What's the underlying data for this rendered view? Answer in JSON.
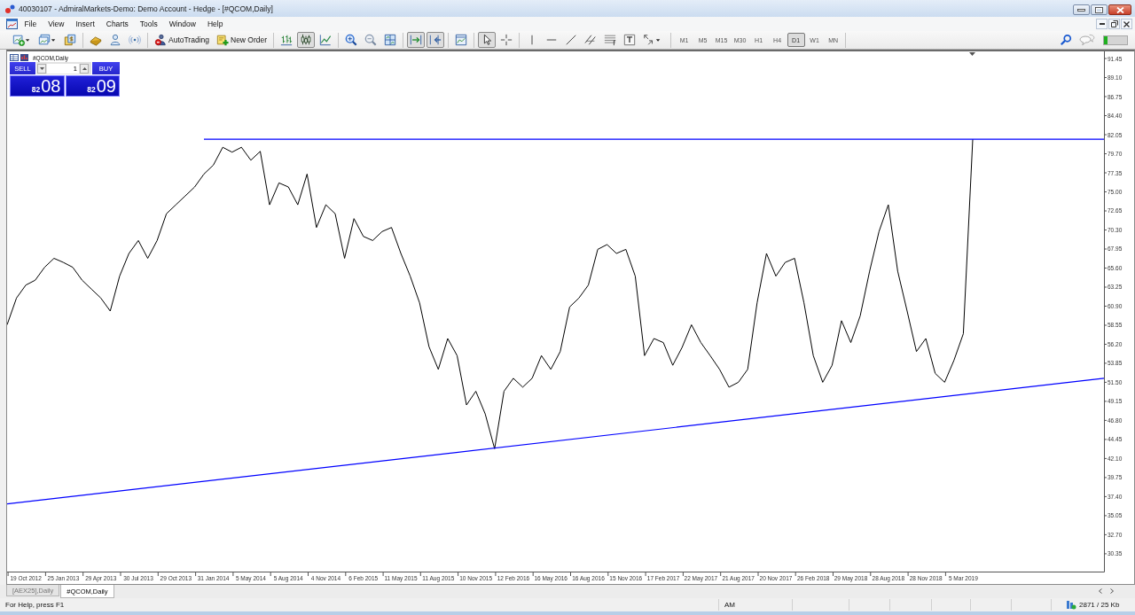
{
  "window": {
    "title": "40030107 - AdmiralMarkets-Demo: Demo Account - Hedge - [#QCOM,Daily]"
  },
  "menu": [
    "File",
    "View",
    "Insert",
    "Charts",
    "Tools",
    "Window",
    "Help"
  ],
  "toolbar": {
    "groups": [
      {
        "items": [
          {
            "kind": "new-chart",
            "pressed": false
          },
          {
            "kind": "profiles",
            "pressed": false
          },
          {
            "kind": "market-watch",
            "pressed": false
          }
        ]
      },
      {
        "items": [
          {
            "kind": "navigator",
            "pressed": false
          },
          {
            "kind": "person",
            "pressed": false
          },
          {
            "kind": "waves",
            "pressed": false
          }
        ]
      },
      {
        "items": [
          {
            "kind": "auto-trading",
            "label": "AutoTrading",
            "pressed": false
          },
          {
            "kind": "new-order",
            "label": "New Order",
            "pressed": false
          }
        ]
      },
      {
        "items": [
          {
            "kind": "bars",
            "pressed": false
          },
          {
            "kind": "candles",
            "pressed": true
          },
          {
            "kind": "line",
            "pressed": false
          }
        ]
      },
      {
        "items": [
          {
            "kind": "zoom-in",
            "pressed": false
          },
          {
            "kind": "zoom-out",
            "pressed": false
          },
          {
            "kind": "tile",
            "pressed": false
          }
        ]
      },
      {
        "items": [
          {
            "kind": "auto-scroll",
            "pressed": true
          },
          {
            "kind": "chart-shift",
            "pressed": true
          }
        ]
      },
      {
        "items": [
          {
            "kind": "templates",
            "pressed": false
          }
        ]
      },
      {
        "items": [
          {
            "kind": "cursor",
            "pressed": true
          },
          {
            "kind": "crosshair",
            "pressed": false
          }
        ]
      },
      {
        "items": [
          {
            "kind": "vline",
            "pressed": false
          },
          {
            "kind": "hline",
            "pressed": false
          },
          {
            "kind": "trendline",
            "pressed": false
          },
          {
            "kind": "channel",
            "pressed": false
          },
          {
            "kind": "fibo",
            "pressed": false
          },
          {
            "kind": "text",
            "pressed": false
          },
          {
            "kind": "arrows",
            "pressed": false
          }
        ]
      }
    ],
    "timeframes": [
      {
        "label": "M1",
        "selected": false
      },
      {
        "label": "M5",
        "selected": false
      },
      {
        "label": "M15",
        "selected": false
      },
      {
        "label": "M30",
        "selected": false
      },
      {
        "label": "H1",
        "selected": false
      },
      {
        "label": "H4",
        "selected": false
      },
      {
        "label": "D1",
        "selected": true
      },
      {
        "label": "W1",
        "selected": false
      },
      {
        "label": "MN",
        "selected": false
      }
    ],
    "meter": {
      "level": 0.15
    }
  },
  "chart": {
    "trade_panel": {
      "sell": {
        "label": "SELL",
        "price_prefix": "82",
        "price_main": "08"
      },
      "lot": "1",
      "buy": {
        "label": "BUY",
        "price_prefix": "82",
        "price_main": "09"
      }
    },
    "chart_data": {
      "type": "line",
      "title": "#QCOM,Daily",
      "ylim": [
        28.15,
        92.33
      ],
      "categories": [
        null,
        null,
        "19 Oct 2012",
        null,
        null,
        null,
        "25 Jan 2013",
        null,
        null,
        null,
        "29 Apr 2013",
        null,
        null,
        null,
        "30 Jul 2013",
        null,
        null,
        null,
        "29 Oct 2013",
        null,
        null,
        null,
        "31 Jan 2014",
        null,
        null,
        null,
        "5 May 2014",
        null,
        null,
        null,
        "5 Aug 2014",
        null,
        null,
        null,
        "4 Nov 2014",
        null,
        null,
        null,
        "6 Feb 2015",
        null,
        null,
        null,
        "11 May 2015",
        null,
        null,
        null,
        "11 Aug 2015",
        null,
        null,
        null,
        "10 Nov 2015",
        null,
        null,
        null,
        "12 Feb 2016",
        null,
        null,
        null,
        "16 May 2016",
        null,
        null,
        null,
        "16 Aug 2016",
        null,
        null,
        null,
        "15 Nov 2016",
        null,
        null,
        null,
        "17 Feb 2017",
        null,
        null,
        null,
        "22 May 2017",
        null,
        null,
        null,
        "21 Aug 2017",
        null,
        null,
        null,
        "20 Nov 2017",
        null,
        null,
        null,
        "26 Feb 2018",
        null,
        null,
        null,
        "29 May 2018",
        null,
        null,
        null,
        "28 Aug 2018",
        null,
        null,
        null,
        "28 Nov 2018",
        null,
        null,
        null,
        "5 Mar 2019",
        null,
        null,
        null,
        null,
        null,
        null,
        null,
        null,
        null,
        null,
        null,
        null,
        null,
        null,
        null
      ],
      "series": [
        {
          "color": "#000000",
          "values": [
            58.6,
            61.9,
            63.5,
            64.1,
            65.7,
            66.8,
            66.3,
            65.7,
            64.1,
            63.0,
            61.9,
            60.3,
            64.6,
            67.4,
            69.0,
            66.8,
            69.0,
            72.3,
            73.4,
            74.5,
            75.6,
            77.2,
            78.3,
            80.5,
            79.9,
            80.5,
            78.9,
            80.0,
            73.4,
            76.1,
            75.6,
            73.4,
            77.2,
            70.6,
            73.4,
            72.3,
            66.8,
            71.7,
            69.5,
            69.0,
            70.1,
            70.6,
            67.4,
            64.6,
            61.3,
            55.9,
            53.1,
            56.9,
            54.8,
            48.7,
            50.4,
            47.6,
            43.3,
            50.4,
            52.0,
            50.9,
            52.0,
            54.8,
            53.1,
            55.3,
            60.8,
            61.9,
            63.5,
            67.9,
            68.5,
            67.4,
            67.9,
            64.6,
            54.8,
            56.9,
            56.4,
            53.6,
            55.8,
            58.6,
            56.4,
            54.8,
            53.1,
            50.9,
            51.5,
            53.1,
            61.3,
            67.4,
            64.6,
            66.3,
            66.8,
            61.3,
            54.8,
            51.5,
            53.6,
            59.1,
            56.4,
            59.7,
            65.2,
            70.1,
            73.4,
            65.2,
            60.3,
            55.3,
            56.9,
            52.6,
            51.5,
            54.2,
            57.5,
            81.5,
            null,
            null,
            null,
            null,
            null,
            null,
            null,
            null,
            null,
            null,
            null,
            null,
            null,
            null
          ]
        },
        {
          "color": "#0000ff",
          "values": [
            null,
            null,
            null,
            null,
            null,
            null,
            null,
            null,
            null,
            null,
            null,
            null,
            null,
            null,
            null,
            null,
            null,
            null,
            null,
            null,
            null,
            81.5,
            null,
            null,
            null,
            null,
            null,
            null,
            null,
            null,
            null,
            null,
            null,
            null,
            null,
            null,
            null,
            null,
            null,
            null,
            null,
            null,
            null,
            null,
            null,
            null,
            null,
            null,
            null,
            null,
            null,
            null,
            null,
            null,
            null,
            null,
            null,
            null,
            null,
            null,
            null,
            null,
            null,
            null,
            null,
            null,
            null,
            null,
            null,
            null,
            null,
            null,
            null,
            null,
            null,
            null,
            null,
            null,
            null,
            null,
            null,
            null,
            null,
            null,
            null,
            null,
            null,
            null,
            null,
            null,
            null,
            null,
            null,
            null,
            null,
            null,
            null,
            null,
            null,
            null,
            null,
            null,
            null,
            null,
            null,
            null,
            null,
            null,
            null,
            null,
            null,
            null,
            null,
            null,
            null,
            null,
            null,
            81.5
          ]
        },
        {
          "color": "#0000ff",
          "values": [
            36.5,
            null,
            null,
            null,
            null,
            null,
            null,
            null,
            null,
            null,
            null,
            null,
            null,
            null,
            null,
            null,
            null,
            null,
            null,
            null,
            null,
            null,
            null,
            null,
            null,
            null,
            null,
            null,
            null,
            null,
            null,
            null,
            null,
            null,
            null,
            null,
            null,
            null,
            null,
            null,
            null,
            null,
            null,
            null,
            null,
            null,
            null,
            null,
            null,
            null,
            null,
            null,
            null,
            null,
            null,
            null,
            null,
            null,
            null,
            null,
            null,
            null,
            null,
            null,
            null,
            null,
            null,
            null,
            null,
            null,
            null,
            null,
            null,
            null,
            null,
            null,
            null,
            null,
            null,
            null,
            null,
            null,
            null,
            null,
            null,
            null,
            null,
            null,
            null,
            null,
            null,
            null,
            null,
            null,
            null,
            null,
            null,
            null,
            null,
            null,
            null,
            null,
            null,
            null,
            null,
            null,
            null,
            null,
            null,
            null,
            null,
            null,
            null,
            null,
            null,
            null,
            null,
            52.0
          ]
        }
      ],
      "yticks": [
        {
          "value": 91.45,
          "label": "91.45"
        },
        {
          "value": 89.1,
          "label": "89.10"
        },
        {
          "value": 86.75,
          "label": "86.75"
        },
        {
          "value": 84.4,
          "label": "84.40"
        },
        {
          "value": 82.05,
          "label": "82.05"
        },
        {
          "value": 79.7,
          "label": "79.70"
        },
        {
          "value": 77.35,
          "label": "77.35"
        },
        {
          "value": 75.0,
          "label": "75.00"
        },
        {
          "value": 72.65,
          "label": "72.65"
        },
        {
          "value": 70.3,
          "label": "70.30"
        },
        {
          "value": 67.95,
          "label": "67.95"
        },
        {
          "value": 65.6,
          "label": "65.60"
        },
        {
          "value": 63.25,
          "label": "63.25"
        },
        {
          "value": 60.9,
          "label": "60.90"
        },
        {
          "value": 58.55,
          "label": "58.55"
        },
        {
          "value": 56.2,
          "label": "56.20"
        },
        {
          "value": 53.85,
          "label": "53.85"
        },
        {
          "value": 51.5,
          "label": "51.50"
        },
        {
          "value": 49.15,
          "label": "49.15"
        },
        {
          "value": 46.8,
          "label": "46.80"
        },
        {
          "value": 44.45,
          "label": "44.45"
        },
        {
          "value": 42.1,
          "label": "42.10"
        },
        {
          "value": 39.75,
          "label": "39.75"
        },
        {
          "value": 37.4,
          "label": "37.40"
        },
        {
          "value": 35.05,
          "label": "35.05"
        },
        {
          "value": 32.7,
          "label": "32.70"
        },
        {
          "value": 30.35,
          "label": "30.35"
        }
      ]
    }
  },
  "tabs": [
    {
      "label": "[AEX25],Daily",
      "selected": false
    },
    {
      "label": "#QCOM,Daily",
      "selected": true
    }
  ],
  "status_bar": {
    "help": "For Help, press F1",
    "cells": [
      "AM"
    ],
    "traffic": "2871 / 25 Kb"
  }
}
